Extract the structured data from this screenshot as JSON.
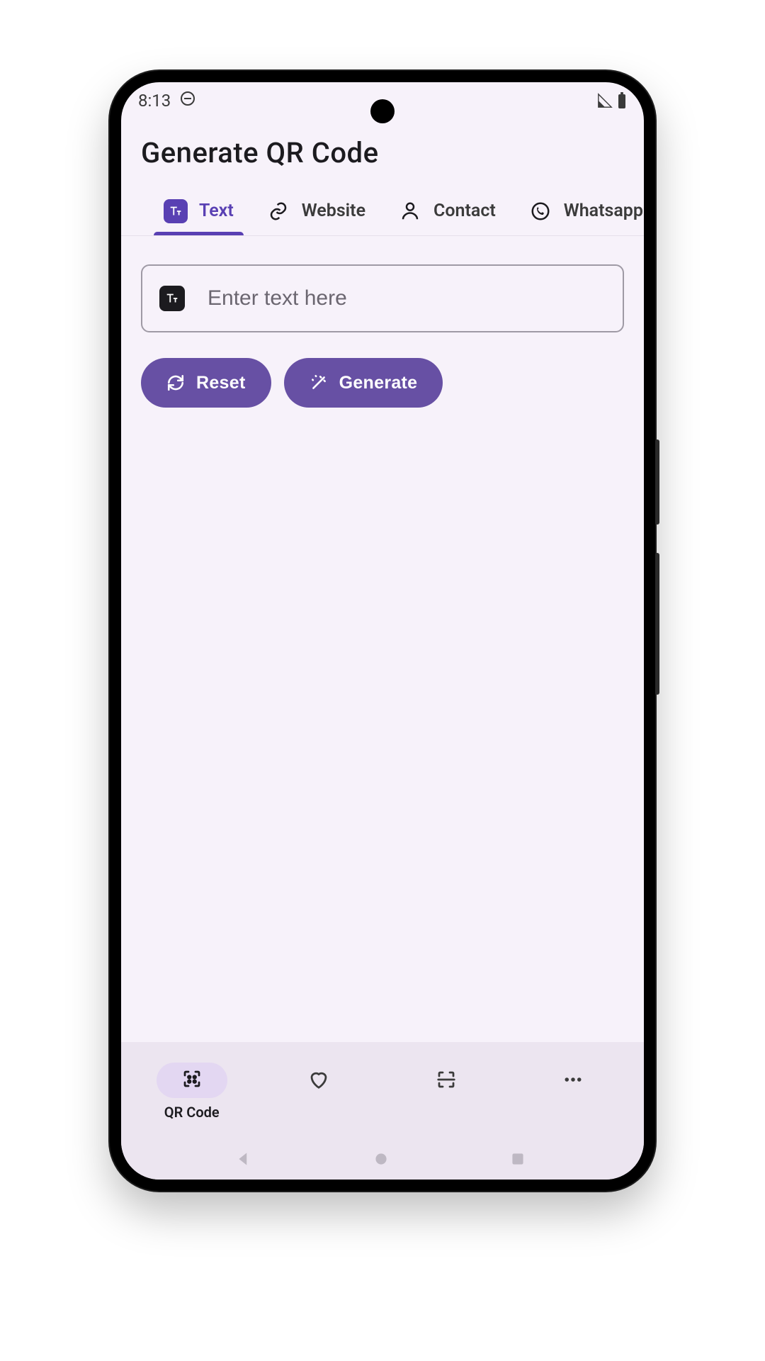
{
  "status": {
    "time": "8:13"
  },
  "header": {
    "title": "Generate QR Code"
  },
  "tabs": [
    {
      "label": "Text",
      "icon": "text-icon",
      "active": true
    },
    {
      "label": "Website",
      "icon": "link-icon",
      "active": false
    },
    {
      "label": "Contact",
      "icon": "person-icon",
      "active": false
    },
    {
      "label": "Whatsapp",
      "icon": "whatsapp-icon",
      "active": false
    }
  ],
  "input": {
    "placeholder": "Enter text here",
    "value": ""
  },
  "actions": {
    "reset_label": "Reset",
    "generate_label": "Generate"
  },
  "bottom_nav": [
    {
      "label": "QR Code",
      "icon": "qr-icon",
      "active": true
    },
    {
      "label": "",
      "icon": "heart-icon",
      "active": false
    },
    {
      "label": "",
      "icon": "scan-icon",
      "active": false
    },
    {
      "label": "",
      "icon": "more-icon",
      "active": false
    }
  ],
  "colors": {
    "accent": "#6750a4",
    "accent_text": "#5940b3",
    "surface": "#f7f2fa",
    "nav_surface": "#ece5f0"
  }
}
